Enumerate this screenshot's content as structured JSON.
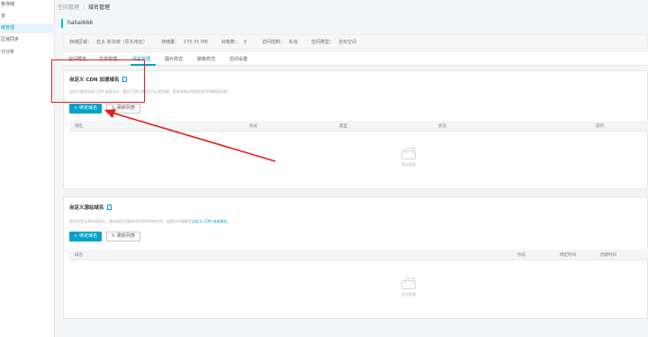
{
  "sidebar": {
    "items": [
      {
        "label": "象存储",
        "active": false
      },
      {
        "label": "览",
        "active": false
      },
      {
        "label": "域管理",
        "active": true
      },
      {
        "label": "区域同步",
        "active": false
      },
      {
        "label": "计分析",
        "active": false
      }
    ]
  },
  "breadcrumb": {
    "parent": "空间管理",
    "separator": "/",
    "current": "域名管理"
  },
  "bucket": {
    "name": "hahai666"
  },
  "info": {
    "region_label": "存储区域：",
    "region_value": "亚太-新加坡（原东南亚）",
    "storage_label": "存储量：",
    "storage_value": "170.35 MB",
    "objects_label": "对象数：",
    "objects_value": "6",
    "access_label": "访问控制：",
    "access_value": "私有",
    "type_label": "空间类型：",
    "type_value": "自有空间"
  },
  "tabs": [
    {
      "label": "空间概览",
      "active": false
    },
    {
      "label": "文件管理",
      "active": false
    },
    {
      "label": "域名管理",
      "active": true
    },
    {
      "label": "图片样式",
      "active": false
    },
    {
      "label": "镜像样式",
      "active": false
    },
    {
      "label": "空间设置",
      "active": false
    }
  ],
  "cdn_panel": {
    "title": "自定义 CDN 加速域名",
    "description": "自定义域名实现 CDN 加速访问，通过 CDN 加速后可以更快速、更高效地访问您的文件和静态资源。",
    "bind_button": "绑定域名",
    "refresh_button": "刷新列表",
    "columns": [
      "域名",
      "协议",
      "类型",
      "状态",
      "操作"
    ],
    "empty_text": "暂无数据"
  },
  "source_panel": {
    "title": "自定义源站域名",
    "description": "绑定自定义源站域名后，源站域名可直接访问空间中的文件，加速访问请绑定",
    "description_link": "自定义 CDN 加速域名。",
    "bind_button": "绑定域名",
    "refresh_button": "刷新列表",
    "columns": [
      "域名",
      "协议",
      "绑定时间",
      "创建时间"
    ],
    "empty_text": "暂无数据"
  },
  "colors": {
    "accent": "#00a2ca",
    "annotation": "#e02020"
  }
}
